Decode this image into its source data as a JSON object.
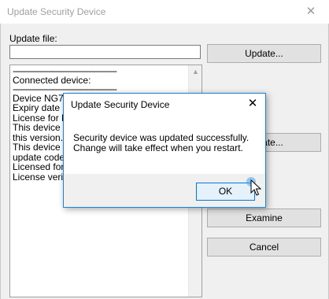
{
  "main_window": {
    "title": "Update Security Device",
    "close_glyph": "✕",
    "update_file_label": "Update file:",
    "update_file_value": "",
    "update_button_1": "Update...",
    "update_button_2": "Update...",
    "examine_button": "Examine",
    "cancel_button": "Cancel"
  },
  "log": {
    "separator": "--------------------------------------------",
    "lines": [
      "Connected device:",
      "Device NG79",
      "Expiry date 20",
      "License for DI",
      "This device (S",
      "this version.",
      "This device (C",
      "update code f",
      "Licensed font",
      "License verifi"
    ]
  },
  "dialog": {
    "title": "Update Security Device",
    "close_glyph": "✕",
    "message_line_1": "Security device was updated successfully.",
    "message_line_2": "Change will take effect when you restart.",
    "ok_button": "OK"
  },
  "colors": {
    "dialog_border": "#1883d7",
    "ok_button_border": "#0078d7"
  }
}
